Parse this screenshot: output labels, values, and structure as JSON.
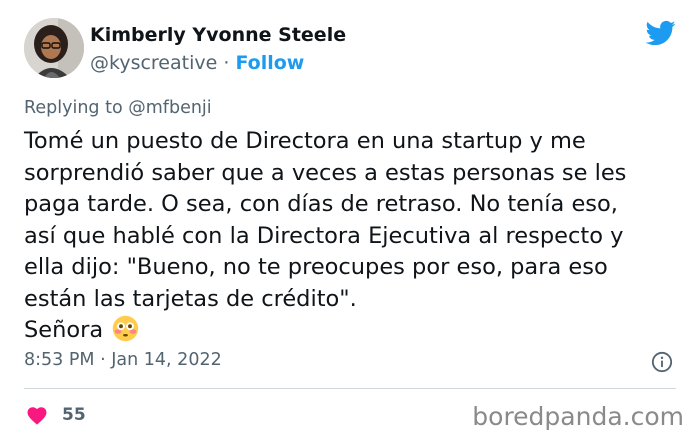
{
  "author": {
    "display_name": "Kimberly Yvonne Steele",
    "handle": "@kyscreative",
    "separator": "·",
    "follow_label": "Follow"
  },
  "reply": {
    "prefix": "Replying to",
    "handle": "@mfbenji"
  },
  "tweet": {
    "lines": [
      "Tomé un puesto de Directora en una startup y me",
      "sorprendió saber que a veces a estas personas se les",
      "paga tarde. O sea, con días de retraso. No tenía eso,",
      "así que hablé con la Directora Ejecutiva al respecto y",
      "ella dijo: \"Bueno, no te preocupes por eso, para eso",
      "están las tarjetas de crédito\".",
      "Señora"
    ],
    "emoji": "flushed-face-emoji"
  },
  "meta": {
    "time": "8:53 PM",
    "separator": "·",
    "date": "Jan 14, 2022"
  },
  "engagement": {
    "likes": "55"
  },
  "watermark": "boredpanda.com",
  "colors": {
    "text": "#0f1419",
    "secondary": "#536471",
    "twitter_blue": "#1d9bf0",
    "like_pink": "#f91880",
    "divider": "#cfd9de"
  },
  "icons": {
    "brand": "twitter-bird-icon",
    "info": "info-icon",
    "like": "heart-icon"
  }
}
